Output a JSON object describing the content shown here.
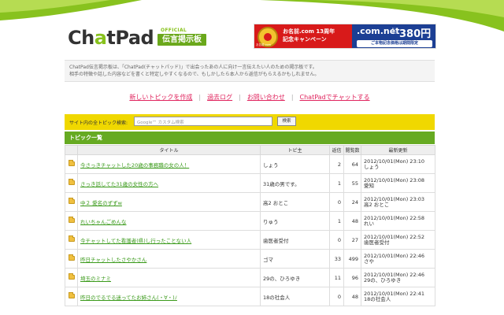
{
  "logo": {
    "name": "ChatPad",
    "official": "OFFICIAL",
    "subtitle": "伝言掲示板"
  },
  "banner": {
    "campaign_line1": "お名前.com 13周年",
    "campaign_line2": "記念キャンペーン",
    "small_text": "お名前.com",
    "comnet": ".com.net",
    "domain_label": "ドメイン",
    "price": "380円",
    "button": "ご本物記念価格は期間限定"
  },
  "intro": {
    "line1": "ChatPad伝言掲示板は、「ChatPad(チャットパッド)」で出会ったあの人に向け一言伝えたい人のための掲示板です。",
    "line2": "相手の特徴や話した内容などを書くと特定しやすくなるので、もしかしたら本人から返信がもらえるかもしれません。"
  },
  "nav": {
    "new_topic": "新しいトピックを作成",
    "archive": "過去ログ",
    "contact": "お問い合わせ",
    "chat": "ChatPadでチャットする"
  },
  "search": {
    "label": "サイト内の全トピック検索:",
    "placeholder": "Google™ カスタム検索",
    "button": "検索"
  },
  "list": {
    "title": "トピック一覧",
    "headers": {
      "title": "タイトル",
      "author": "トピ主",
      "replies": "返信",
      "views": "閲覧数",
      "updated": "最新更新"
    },
    "rows": [
      {
        "title": "今さっきチャットした20歳の事務職の女の人！",
        "author": "しょう",
        "replies": "2",
        "views": "64",
        "updated": "2012/10/01(Mon) 23:10",
        "updater": "しょう"
      },
      {
        "title": "さっき話してた31歳の女性の方へ",
        "author": "31歳の男です。",
        "replies": "1",
        "views": "55",
        "updated": "2012/10/01(Mon) 23:08",
        "updater": "愛知"
      },
      {
        "title": "中２ 愛名のずずw",
        "author": "高2 おとこ",
        "replies": "0",
        "views": "24",
        "updated": "2012/10/01(Mon) 23:03",
        "updater": "高2 おとこ"
      },
      {
        "title": "れいちゃんごめんな",
        "author": "りゅう",
        "replies": "1",
        "views": "48",
        "updated": "2012/10/01(Mon) 22:58",
        "updater": "れい"
      },
      {
        "title": "今チャットしてた看護者(県)し行ったことない人",
        "author": "歯医者受付",
        "replies": "0",
        "views": "27",
        "updated": "2012/10/01(Mon) 22:52",
        "updater": "歯医者受付"
      },
      {
        "title": "昨日チャットしたさやかさん",
        "author": "ゴマ",
        "replies": "33",
        "views": "499",
        "updated": "2012/10/01(Mon) 22:46",
        "updater": "さや"
      },
      {
        "title": "埼玉のミナミ",
        "author": "29の、ひろゆき",
        "replies": "11",
        "views": "96",
        "updated": "2012/10/01(Mon) 22:46",
        "updater": "29の、ひろゆき"
      },
      {
        "title": "昨日のでるでる迷ってたお姉さん(・∀・)ﾉ",
        "author": "18の社会人",
        "replies": "0",
        "views": "48",
        "updated": "2012/10/01(Mon) 22:41",
        "updater": "18の社会人"
      }
    ]
  }
}
